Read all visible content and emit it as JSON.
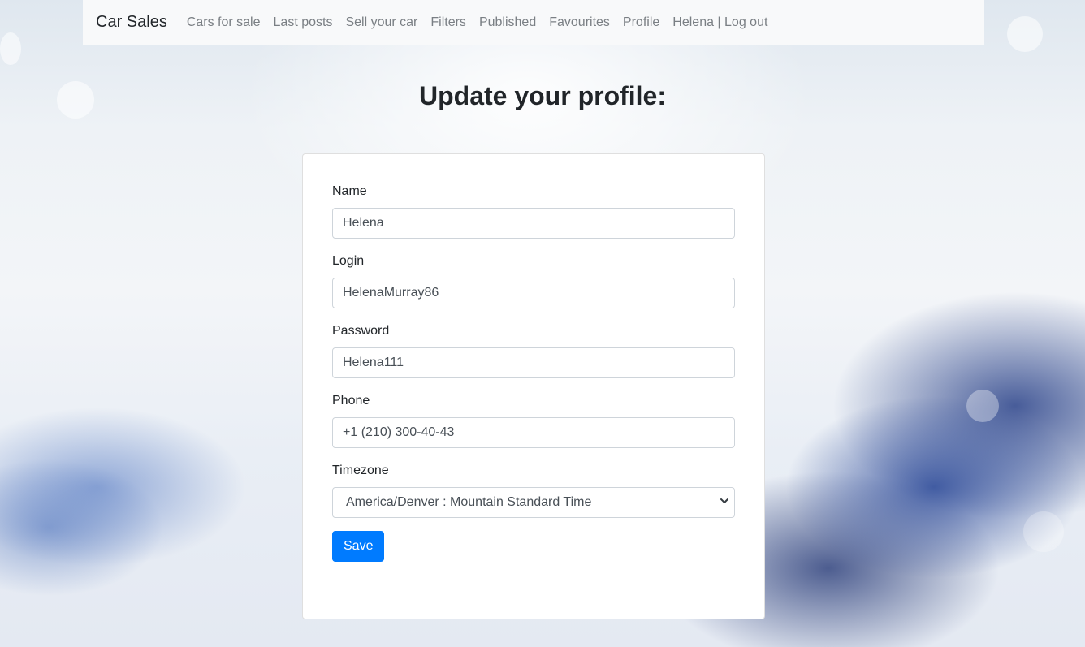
{
  "nav": {
    "brand": "Car Sales",
    "links": [
      "Cars for sale",
      "Last posts",
      "Sell your car",
      "Filters",
      "Published",
      "Favourites",
      "Profile",
      "Helena | Log out"
    ]
  },
  "page": {
    "title": "Update your profile:"
  },
  "form": {
    "name": {
      "label": "Name",
      "value": "Helena"
    },
    "login": {
      "label": "Login",
      "value": "HelenaMurray86"
    },
    "password": {
      "label": "Password",
      "value": "Helena111"
    },
    "phone": {
      "label": "Phone",
      "value": "+1 (210) 300-40-43"
    },
    "timezone": {
      "label": "Timezone",
      "value": "America/Denver : Mountain Standard Time"
    },
    "save_label": "Save"
  },
  "colors": {
    "primary": "#007bff",
    "navbar_bg": "#f8f9fa"
  }
}
